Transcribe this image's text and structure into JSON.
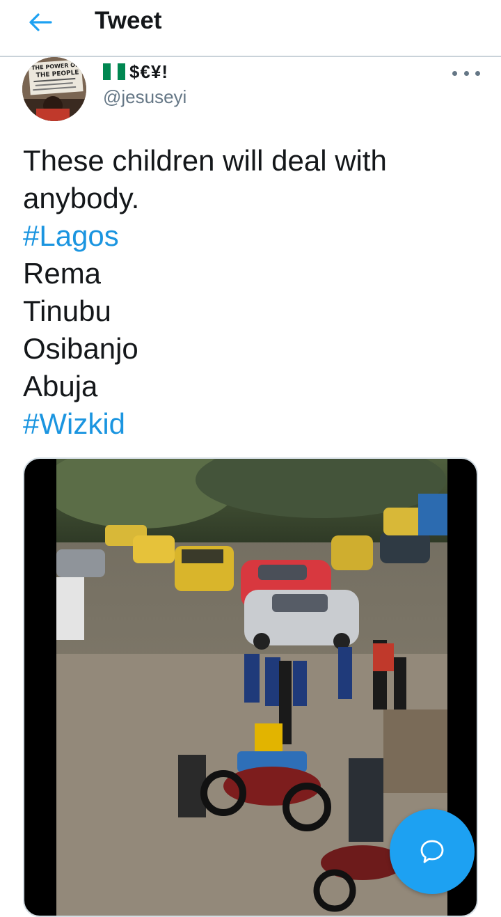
{
  "header": {
    "title": "Tweet",
    "back_icon": "arrow-left-icon"
  },
  "user": {
    "flag_icon": "nigeria-flag-icon",
    "display_name": "$€¥!",
    "handle": "@jesuseyi",
    "avatar_sign_text": "THE POWER OF THE PEOPLE"
  },
  "tweet": {
    "lines": [
      {
        "text": "These children will deal with",
        "type": "text"
      },
      {
        "text": "anybody.",
        "type": "text"
      },
      {
        "text": "#Lagos",
        "type": "hashtag"
      },
      {
        "text": "Rema",
        "type": "text"
      },
      {
        "text": "Tinubu",
        "type": "text"
      },
      {
        "text": "Osibanjo",
        "type": "text"
      },
      {
        "text": "Abuja",
        "type": "text"
      },
      {
        "text": "#Wizkid",
        "type": "hashtag"
      }
    ]
  },
  "actions": {
    "more_icon": "more-dots-icon",
    "compose_icon": "reply-bubble-icon"
  },
  "colors": {
    "accent": "#1da1f2",
    "hashtag": "#1b95e0",
    "secondary_text": "#657786",
    "divider": "#c9d2d9"
  }
}
